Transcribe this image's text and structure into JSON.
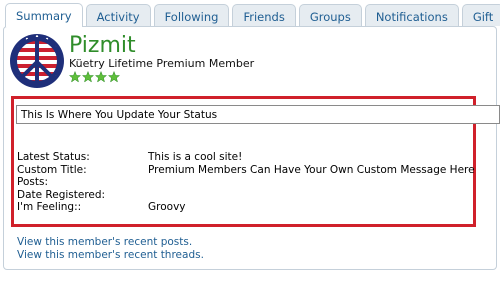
{
  "tabs": [
    {
      "label": "Summary",
      "active": true
    },
    {
      "label": "Activity",
      "active": false
    },
    {
      "label": "Following",
      "active": false
    },
    {
      "label": "Friends",
      "active": false
    },
    {
      "label": "Groups",
      "active": false
    },
    {
      "label": "Notifications",
      "active": false
    },
    {
      "label": "Gift",
      "active": false
    }
  ],
  "profile": {
    "username": "Pizmit",
    "member_title": "Küetry Lifetime Premium Member",
    "avatar_icon": "peace-sign-flag-icon",
    "star_count": 4,
    "star_icon": "green-star-icon"
  },
  "status_input": {
    "value": "This Is Where You Update Your Status"
  },
  "details": [
    {
      "label": "Latest Status:",
      "value": "This is a cool site!"
    },
    {
      "label": "Custom Title:",
      "value": "Premium Members Can Have Your Own Custom Message Here"
    },
    {
      "label": "Posts:",
      "value": ""
    },
    {
      "label": "Date Registered:",
      "value": ""
    },
    {
      "label": "I'm Feeling::",
      "value": "Groovy"
    }
  ],
  "links": {
    "recent_posts": "View this member's recent posts.",
    "recent_threads": "View this member's recent threads."
  },
  "colors": {
    "username": "#2f8d2a",
    "link": "#1f5e92",
    "highlight_border": "#d0202a",
    "tab_bg": "#e6ecf1"
  }
}
